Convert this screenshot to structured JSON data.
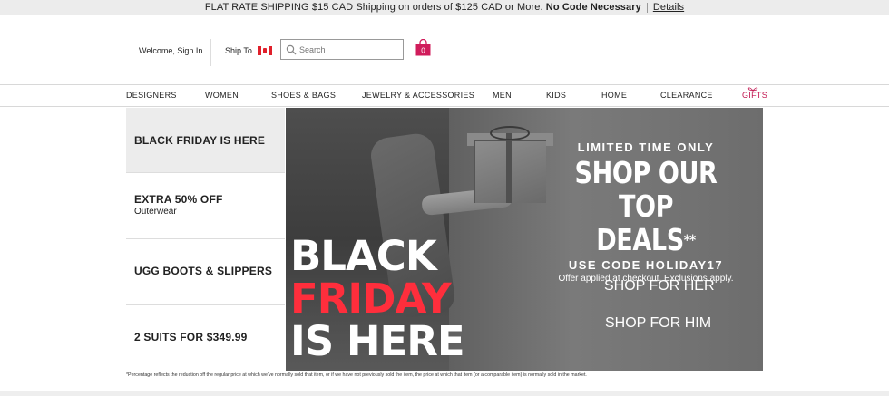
{
  "promo": {
    "text": "FLAT RATE SHIPPING $15 CAD Shipping on orders of $125 CAD or More.",
    "bold": "No Code Necessary",
    "details": "Details"
  },
  "header": {
    "welcome": "Welcome, Sign In",
    "ship_to": "Ship To",
    "search_placeholder": "Search",
    "bag_count": "0"
  },
  "nav": {
    "items": [
      "DESIGNERS",
      "WOMEN",
      "SHOES & BAGS",
      "JEWELRY & ACCESSORIES",
      "MEN",
      "KIDS",
      "HOME",
      "CLEARANCE",
      "GIFTS"
    ]
  },
  "sidebar": {
    "items": [
      {
        "title": "BLACK FRIDAY IS HERE",
        "subtitle": ""
      },
      {
        "title": "EXTRA 50% OFF",
        "subtitle": "Outerwear"
      },
      {
        "title": "UGG BOOTS & SLIPPERS",
        "subtitle": ""
      },
      {
        "title": "2 SUITS FOR $349.99",
        "subtitle": ""
      }
    ]
  },
  "hero": {
    "headline": [
      "BLACK",
      "FRIDAY",
      "IS HERE"
    ],
    "limited": "LIMITED TIME ONLY",
    "shop_line1": "SHOP OUR TOP",
    "shop_line2": "DEALS",
    "shop_mark": "**",
    "code": "USE CODE HOLIDAY17",
    "offer": "Offer applied at checkout. Exclusions apply.",
    "cta_her": "SHOP FOR HER",
    "cta_him": "SHOP FOR HIM"
  },
  "footnote": "*Percentage reflects the reduction off the regular price at which we've normally sold that item, or if we have not previously sold the item, the price at which that item (or a comparable item) is normally sold in the market.",
  "colors": {
    "accent": "#c1134e",
    "bag": "#d01c5b",
    "friday_red": "#ff2e3c"
  }
}
